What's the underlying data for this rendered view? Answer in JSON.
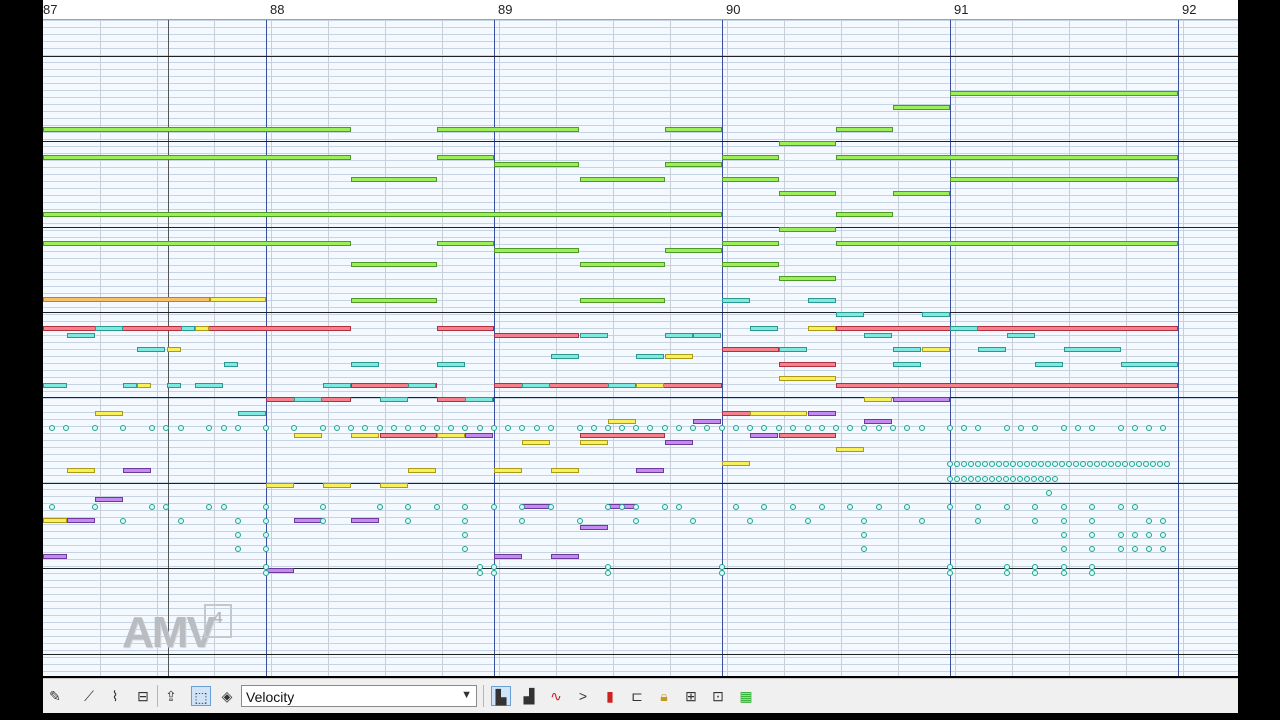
{
  "ruler": {
    "bars": [
      "87",
      "88",
      "89",
      "90",
      "91",
      "92"
    ]
  },
  "colors": {
    "bar_line": "#3a4fa0",
    "note_green": "#9bef58",
    "note_red": "#f5818c",
    "note_cyan": "#7fe8e0",
    "note_yellow": "#f7ef5b",
    "note_purple": "#c48af0",
    "note_orange": "#f7bf6a"
  },
  "watermark": {
    "text": "AMV",
    "box_text": "4"
  },
  "toolbar": {
    "controller_select": {
      "value": "Velocity"
    },
    "icons": [
      "pen-tool-icon",
      "waveform-icon",
      "eraser-icon",
      "line-tool-icon",
      "select-rect-icon",
      "paint-icon",
      "piano-roll-icon",
      "keyboard-icon",
      "curve-icon",
      "play-arrow-icon",
      "level-meter-icon",
      "link-icon",
      "lock-icon",
      "split-icon",
      "scope-icon",
      "mixer-icon"
    ]
  }
}
